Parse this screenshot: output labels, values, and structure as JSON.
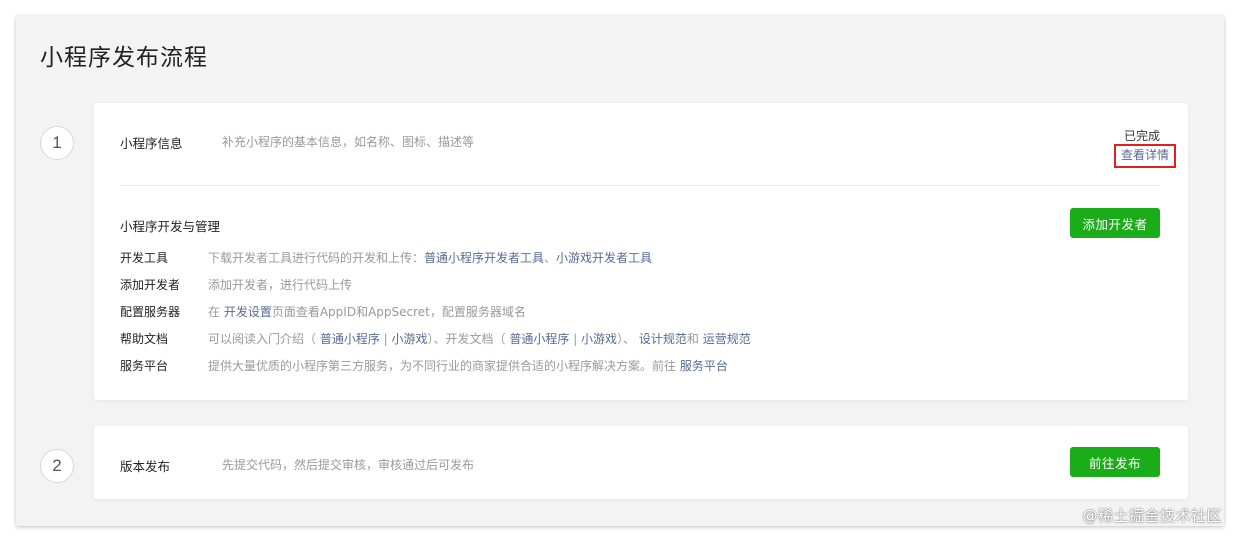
{
  "page": {
    "title": "小程序发布流程"
  },
  "step1": {
    "number": "1",
    "title": "小程序信息",
    "description": "补充小程序的基本信息，如名称、图标、描述等",
    "status": "已完成",
    "detail_link": "查看详情",
    "section_title": "小程序开发与管理",
    "add_button": "添加开发者",
    "rows": [
      {
        "label": "开发工具",
        "parts": [
          {
            "t": "下载开发者工具进行代码的开发和上传：",
            "link": false
          },
          {
            "t": "普通小程序开发者工具",
            "link": true
          },
          {
            "t": "、",
            "link": false
          },
          {
            "t": "小游戏开发者工具",
            "link": true
          }
        ]
      },
      {
        "label": "添加开发者",
        "parts": [
          {
            "t": "添加开发者，进行代码上传",
            "link": false
          }
        ]
      },
      {
        "label": "配置服务器",
        "parts": [
          {
            "t": "在 ",
            "link": false
          },
          {
            "t": "开发设置",
            "link": true
          },
          {
            "t": "页面查看AppID和AppSecret，配置服务器域名",
            "link": false
          }
        ]
      },
      {
        "label": "帮助文档",
        "parts": [
          {
            "t": "可以阅读入门介绍（ ",
            "link": false
          },
          {
            "t": "普通小程序",
            "link": true
          },
          {
            "t": " | ",
            "link": false
          },
          {
            "t": "小游戏",
            "link": true
          },
          {
            "t": "）、开发文档（ ",
            "link": false
          },
          {
            "t": "普通小程序",
            "link": true
          },
          {
            "t": " | ",
            "link": false
          },
          {
            "t": "小游戏",
            "link": true
          },
          {
            "t": "）、 ",
            "link": false
          },
          {
            "t": "设计规范",
            "link": true
          },
          {
            "t": "和 ",
            "link": false
          },
          {
            "t": "运营规范",
            "link": true
          }
        ]
      },
      {
        "label": "服务平台",
        "parts": [
          {
            "t": "提供大量优质的小程序第三方服务，为不同行业的商家提供合适的小程序解决方案。前往 ",
            "link": false
          },
          {
            "t": "服务平台",
            "link": true
          }
        ]
      }
    ]
  },
  "step2": {
    "number": "2",
    "title": "版本发布",
    "description": "先提交代码，然后提交审核，审核通过后可发布",
    "publish_button": "前往发布"
  },
  "watermark": "@稀土掘金技术社区",
  "colors": {
    "accent_green": "#1aad19",
    "link_blue": "#576b95",
    "highlight_red": "#e02020"
  }
}
